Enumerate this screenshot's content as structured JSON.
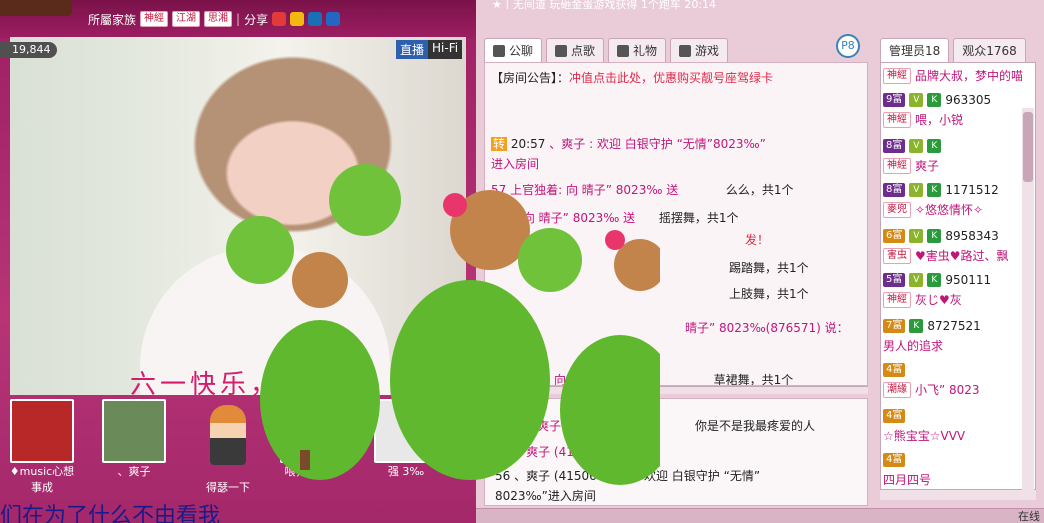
{
  "left": {
    "family_label": "所屬家族",
    "family_tags": [
      "神經",
      "江湖",
      "思湘"
    ],
    "share_label": "分享",
    "viewer_count": "19,844",
    "live_label": "直播",
    "hifi_label": "Hi-Fi",
    "overlay_text": "六一快乐，   ，正",
    "bottom_scroll": "们在为了什么不由看我",
    "gifts": [
      {
        "name": "♦music心想事成",
        "color": "#c03030"
      },
      {
        "name": "、爽子",
        "color": "#6a8a5a"
      },
      {
        "name": "得瑟一下",
        "color": ""
      },
      {
        "name": "喂，野性爷",
        "color": "#7a5a7a"
      },
      {
        "name": "强 3‰",
        "color": "#ddd"
      }
    ]
  },
  "right": {
    "marquee": "★丨无间道 玩砸金蛋游戏获得 1个跑车  20:14",
    "tabs": [
      "公聊",
      "点歌",
      "礼物",
      "游戏"
    ],
    "announcement_label": "【房间公告】：",
    "announcement": "冲值点击此处，优惠购买靓号座驾绿卡",
    "messages": [
      {
        "time": "20:57",
        "badge": "转",
        "text": "、爽子 : 欢迎 白银守护 “无情”8023‰”"
      },
      {
        "text": "进入房间"
      },
      {
        "text": "57 上官独着: 向 晴子” 8023‰ 送",
        "tail": "么么，共1个"
      },
      {
        "text": "爽子: 向 晴子” 8023‰ 送",
        "tail": "摇摆舞，共1个"
      },
      {
        "text": "发！"
      },
      {
        "text": "",
        "tail": "踢踏舞，共1个"
      },
      {
        "text": "",
        "tail": "上肢舞，共1个"
      },
      {
        "text": "晴子” 8023‰(876571) 说："
      },
      {
        "text": "58 、爽子: 向",
        "tail": "草裙舞，共1个"
      }
    ],
    "private_messages": [
      {
        "text": "爽子 (41"
      },
      {
        "text": "你是不是我最疼爱的人"
      },
      {
        "text": "56 、爽子 (41506756) 对"
      },
      {
        "text": "56 、爽子 (41506756) 对    欢迎  白银守护  “无情”"
      },
      {
        "text": "8023‰”进入房间"
      }
    ],
    "round_badge": "P8",
    "user_tabs": [
      "管理员18",
      "观众1768"
    ],
    "users": [
      {
        "tag": "神經",
        "name": "品牌大叔，梦中的喵"
      },
      {
        "level": "9富",
        "id": "963305",
        "tag": "神經",
        "name": "喂，小锐"
      },
      {
        "level": "8富",
        "tag": "神經",
        "name": "爽子"
      },
      {
        "level": "8富",
        "id": "1171512",
        "tag": "麥兜",
        "name": "✧悠悠情怀✧"
      },
      {
        "level": "6富",
        "id": "8958343",
        "tag": "害虫",
        "name": "♥害虫♥路过、飘"
      },
      {
        "level": "5富",
        "id": "950111",
        "tag": "神經",
        "name": "灰じ♥灰"
      },
      {
        "level": "7富",
        "id": "8727521",
        "name": "男人的追求"
      },
      {
        "level": "4富",
        "tag": "潮緣",
        "name": "小飞” 8023"
      },
      {
        "level": "4富",
        "name": "☆熊宝宝☆VVV"
      },
      {
        "level": "4富",
        "name": "四月四号"
      }
    ],
    "online_label": "在线"
  }
}
